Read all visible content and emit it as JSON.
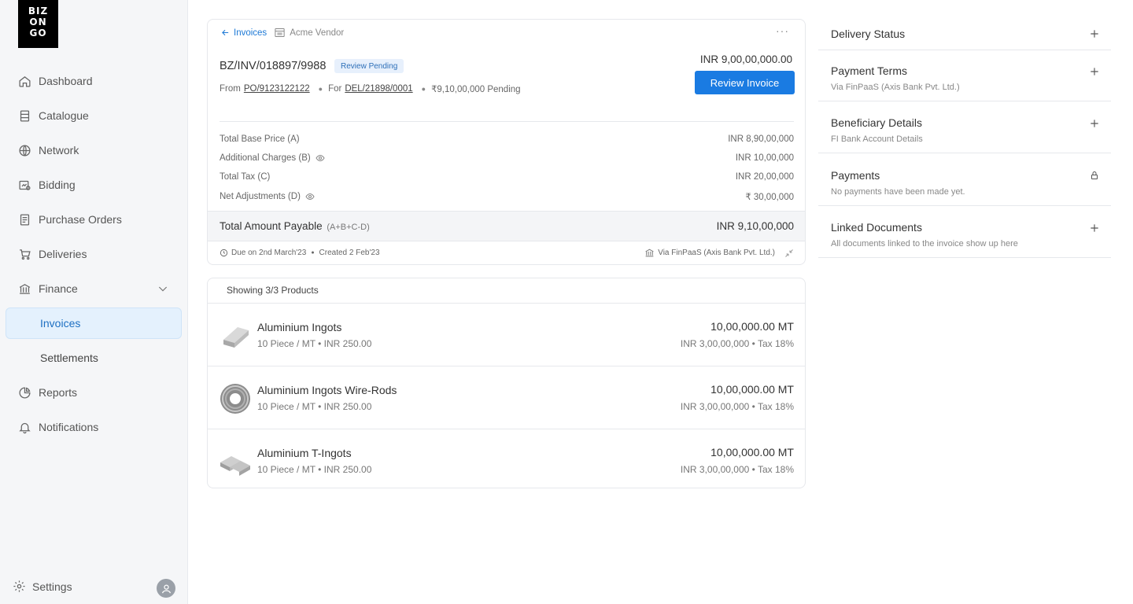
{
  "logo": {
    "line1": "BIZ",
    "line2": "ON",
    "line3": "GO"
  },
  "sidebar": {
    "items": [
      {
        "label": "Dashboard",
        "icon": "home-icon"
      },
      {
        "label": "Catalogue",
        "icon": "catalogue-icon"
      },
      {
        "label": "Network",
        "icon": "globe-icon"
      },
      {
        "label": "Bidding",
        "icon": "bidding-icon"
      },
      {
        "label": "Purchase Orders",
        "icon": "document-icon"
      },
      {
        "label": "Deliveries",
        "icon": "cart-icon"
      },
      {
        "label": "Finance",
        "icon": "bank-icon"
      },
      {
        "label": "Reports",
        "icon": "pie-chart-icon"
      },
      {
        "label": "Notifications",
        "icon": "bell-icon"
      }
    ],
    "finance_sub": [
      {
        "label": "Invoices",
        "active": true
      },
      {
        "label": "Settlements",
        "active": false
      }
    ],
    "settings_label": "Settings",
    "active_color": "#1d6fc2"
  },
  "invoice": {
    "breadcrumb_back": "Invoices",
    "vendor": "Acme Vendor",
    "more": "···",
    "number": "BZ/INV/018897/9988",
    "status_badge": "Review Pending",
    "from_label": "From",
    "po_number": "PO/9123122122",
    "for_label": "For",
    "del_number": "DEL/21898/0001",
    "pending": "₹9,10,00,000 Pending",
    "amount": "INR 9,00,00,000.00",
    "review_button": "Review Invoice",
    "lines": [
      {
        "label": "Total Base Price (A)",
        "value": "INR 8,90,00,000",
        "eye": false
      },
      {
        "label": "Additional Charges (B)",
        "value": "INR 10,00,000",
        "eye": true
      },
      {
        "label": "Total Tax (C)",
        "value": "INR 20,00,000",
        "eye": false
      },
      {
        "label": "Net Adjustments (D)",
        "value": "₹ 30,00,000",
        "eye": true
      }
    ],
    "total_label": "Total Amount Payable",
    "total_formula": "(A+B+C-D)",
    "total_value": "INR 9,10,00,000",
    "due": "Due on 2nd March'23",
    "created": "Created 2 Feb'23",
    "via": "Via FinPaaS (Axis Bank Pvt. Ltd.)",
    "accent_color": "#1a7be2"
  },
  "products": {
    "heading": "Showing 3/3 Products",
    "items": [
      {
        "name": "Aluminium Ingots",
        "desc": "10 Piece / MT • INR 250.00",
        "qty": "10,00,000.00 MT",
        "price": "INR 3,00,00,000 • Tax 18%"
      },
      {
        "name": "Aluminium Ingots Wire-Rods",
        "desc": "10 Piece / MT • INR 250.00",
        "qty": "10,00,000.00 MT",
        "price": "INR 3,00,00,000 • Tax 18%"
      },
      {
        "name": "Aluminium T-Ingots",
        "desc": "10 Piece / MT • INR 250.00",
        "qty": "10,00,000.00 MT",
        "price": "INR 3,00,00,000 • Tax 18%"
      }
    ]
  },
  "panels": [
    {
      "title": "Delivery Status",
      "subtitle": "",
      "icon": "plus-icon"
    },
    {
      "title": "Payment Terms",
      "subtitle": "Via FinPaaS (Axis Bank Pvt. Ltd.)",
      "icon": "plus-icon"
    },
    {
      "title": "Beneficiary Details",
      "subtitle": "FI Bank Account Details",
      "icon": "plus-icon"
    },
    {
      "title": "Payments",
      "subtitle": "No payments have been made yet.",
      "icon": "lock-icon"
    },
    {
      "title": "Linked Documents",
      "subtitle": "All documents linked to the invoice show up here",
      "icon": "plus-icon"
    }
  ]
}
